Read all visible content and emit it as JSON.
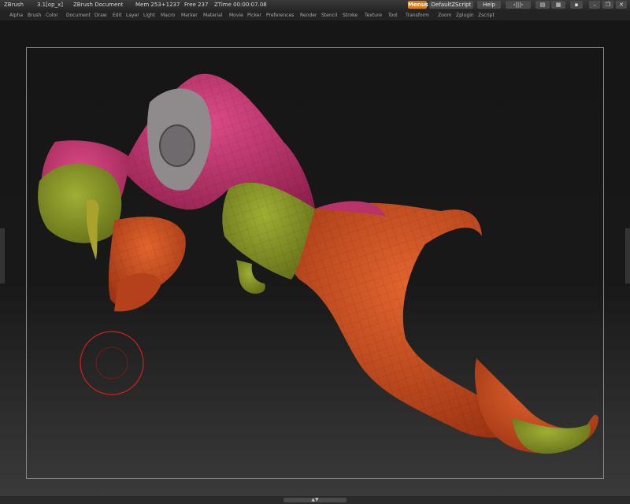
{
  "titlebar": {
    "app": "ZBrush",
    "version": "3.1[op_x]",
    "document": "ZBrush Document",
    "mem": "Mem 253+1237",
    "free": "Free 237",
    "ztime": "ZTime 00:00:07.08"
  },
  "controls": {
    "menus": "Menus",
    "script": "DefaultZScript",
    "help": "Help"
  },
  "menu": {
    "items": [
      "Alpha",
      "Brush",
      "Color",
      "Document",
      "Draw",
      "Edit",
      "Layer",
      "Light",
      "Macro",
      "Marker",
      "Material",
      "Movie",
      "Picker",
      "Preferences",
      "Render",
      "Stencil",
      "Stroke",
      "Texture",
      "Tool",
      "Transform",
      "Zoom",
      "Zplugin",
      "Zscript"
    ]
  },
  "icons": {
    "brush_cursor": "brush-cursor-icon",
    "window_controls": [
      "minimize-icon",
      "restore-icon",
      "close-icon"
    ]
  },
  "colors": {
    "accent": "#e07a10",
    "mask_pink": "#c2356e",
    "mask_orange": "#c94a22",
    "mask_olive": "#7d8a22",
    "brush_ring": "#d02020"
  }
}
